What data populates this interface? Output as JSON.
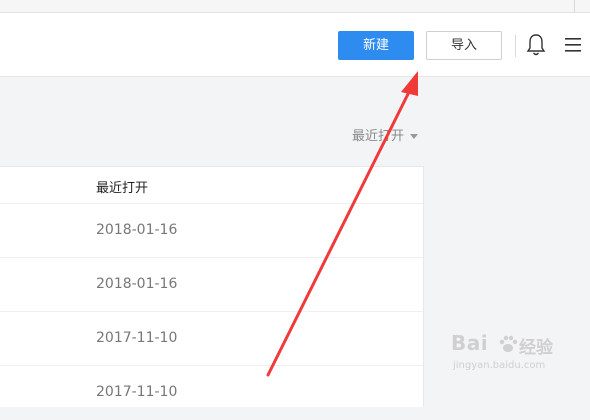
{
  "toolbar": {
    "new_label": "新建",
    "import_label": "导入",
    "bell_icon": "bell-icon",
    "menu_icon": "hamburger-menu-icon",
    "new_color": "#2e8cf0"
  },
  "sort": {
    "label": "最近打开"
  },
  "table": {
    "header": "最近打开",
    "rows": [
      {
        "date": "2018-01-16"
      },
      {
        "date": "2018-01-16"
      },
      {
        "date": "2017-11-10"
      },
      {
        "date": "2017-11-10"
      }
    ]
  },
  "annotation": {
    "color": "#f03a3a"
  },
  "watermark": {
    "brand": "Bai",
    "brand_right": "经验",
    "url": "jingyan.baidu.com"
  }
}
